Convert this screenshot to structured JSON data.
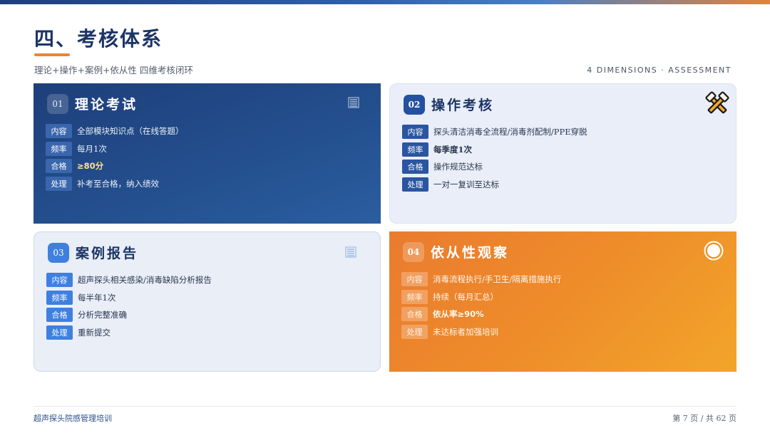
{
  "header": {
    "title": "四、考核体系",
    "subtitle": "理论+操作+案例+依从性 四维考核闭环",
    "subtitle_en": "4 DIMENSIONS · ASSESSMENT"
  },
  "colors": {
    "accent_orange": "#e8843a",
    "navy": "#1e3f7a",
    "blue": "#2450a0"
  },
  "cards": [
    {
      "num": "01",
      "title": "理论考试",
      "icon": "document-lines-icon",
      "rows": [
        {
          "tag": "内容",
          "value": "全部模块知识点（在线答题）"
        },
        {
          "tag": "频率",
          "value": "每月1次"
        },
        {
          "tag": "合格",
          "value": "≥80分"
        },
        {
          "tag": "处理",
          "value": "补考至合格，纳入绩效"
        }
      ]
    },
    {
      "num": "02",
      "title": "操作考核",
      "icon": "hammer-wrench-icon",
      "rows": [
        {
          "tag": "内容",
          "value": "探头清洁消毒全流程/消毒剂配制/PPE穿脱"
        },
        {
          "tag": "频率",
          "value": "每季度1次"
        },
        {
          "tag": "合格",
          "value": "操作规范达标"
        },
        {
          "tag": "处理",
          "value": "一对一复训至达标"
        }
      ]
    },
    {
      "num": "03",
      "title": "案例报告",
      "icon": "document-lines-icon",
      "rows": [
        {
          "tag": "内容",
          "value": "超声探头相关感染/消毒缺陷分析报告"
        },
        {
          "tag": "频率",
          "value": "每半年1次"
        },
        {
          "tag": "合格",
          "value": "分析完整准确"
        },
        {
          "tag": "处理",
          "value": "重新提交"
        }
      ]
    },
    {
      "num": "04",
      "title": "依从性观察",
      "icon": "circle-check-icon",
      "rows": [
        {
          "tag": "内容",
          "value": "消毒流程执行/手卫生/隔离措施执行"
        },
        {
          "tag": "频率",
          "value": "持续（每月汇总）"
        },
        {
          "tag": "合格",
          "value": "依从率≥90%"
        },
        {
          "tag": "处理",
          "value": "未达标者加强培训"
        }
      ]
    }
  ],
  "footer": {
    "left": "超声探头院感管理培训",
    "right": "第 7 页 / 共 62 页"
  }
}
